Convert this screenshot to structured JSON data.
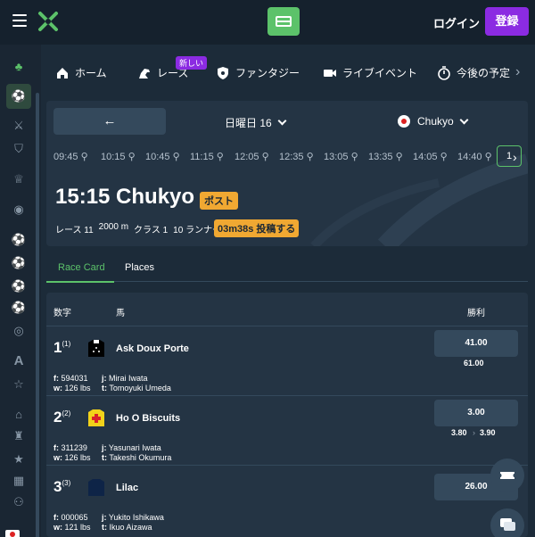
{
  "header": {
    "login_label": "ログイン",
    "register_label": "登録"
  },
  "nav": {
    "items": [
      {
        "label": "ホーム",
        "icon": "home-icon"
      },
      {
        "label": "レース",
        "icon": "horse-icon"
      },
      {
        "label": "ファンタジー",
        "icon": "shield-icon"
      },
      {
        "label": "ライブイベント",
        "icon": "video-icon"
      },
      {
        "label": "今後の予定",
        "icon": "stopwatch-icon"
      }
    ],
    "new_badge": "新しい"
  },
  "race_panel": {
    "date_label": "日曜日 16",
    "track_label": "Chukyo",
    "times": [
      "09:45",
      "10:15",
      "10:45",
      "11:15",
      "12:05",
      "12:35",
      "13:05",
      "13:35",
      "14:05",
      "14:40",
      "1"
    ],
    "title": "15:15 Chukyo",
    "post_badge": "ポスト",
    "meta": [
      "レース 11",
      "2000 m",
      "クラス 1",
      "10 ランナー"
    ],
    "countdown": "03m38s 投稿する"
  },
  "tabs": [
    {
      "label": "Race Card"
    },
    {
      "label": "Places"
    }
  ],
  "table": {
    "headers": {
      "number": "数字",
      "horse": "馬",
      "win": "勝利"
    },
    "runners": [
      {
        "number": "1",
        "draw": "(1)",
        "name": "Ask Doux Porte",
        "form": "594031",
        "weight": "126 lbs",
        "jockey": "Mirai Iwata",
        "trainer": "Tomoyuki Umeda",
        "odds": "41.00",
        "odds_sub": [
          "61.00"
        ]
      },
      {
        "number": "2",
        "draw": "(2)",
        "name": "Ho O Biscuits",
        "form": "311239",
        "weight": "126 lbs",
        "jockey": "Yasunari Iwata",
        "trainer": "Takeshi Okumura",
        "odds": "3.00",
        "odds_sub": [
          "3.80",
          "3.90"
        ]
      },
      {
        "number": "3",
        "draw": "(3)",
        "name": "Lilac",
        "form": "000065",
        "weight": "121 lbs",
        "jockey": "Yukito Ishikawa",
        "trainer": "Ikuo Aizawa",
        "odds": "26.00",
        "odds_sub": []
      }
    ],
    "labels": {
      "form": "f:",
      "weight": "w:",
      "jockey": "j:",
      "trainer": "t:"
    }
  },
  "colors": {
    "accent": "#5cc26a",
    "brand": "#8b2be2",
    "badge": "#f0a832",
    "background": "#1c2b39"
  }
}
